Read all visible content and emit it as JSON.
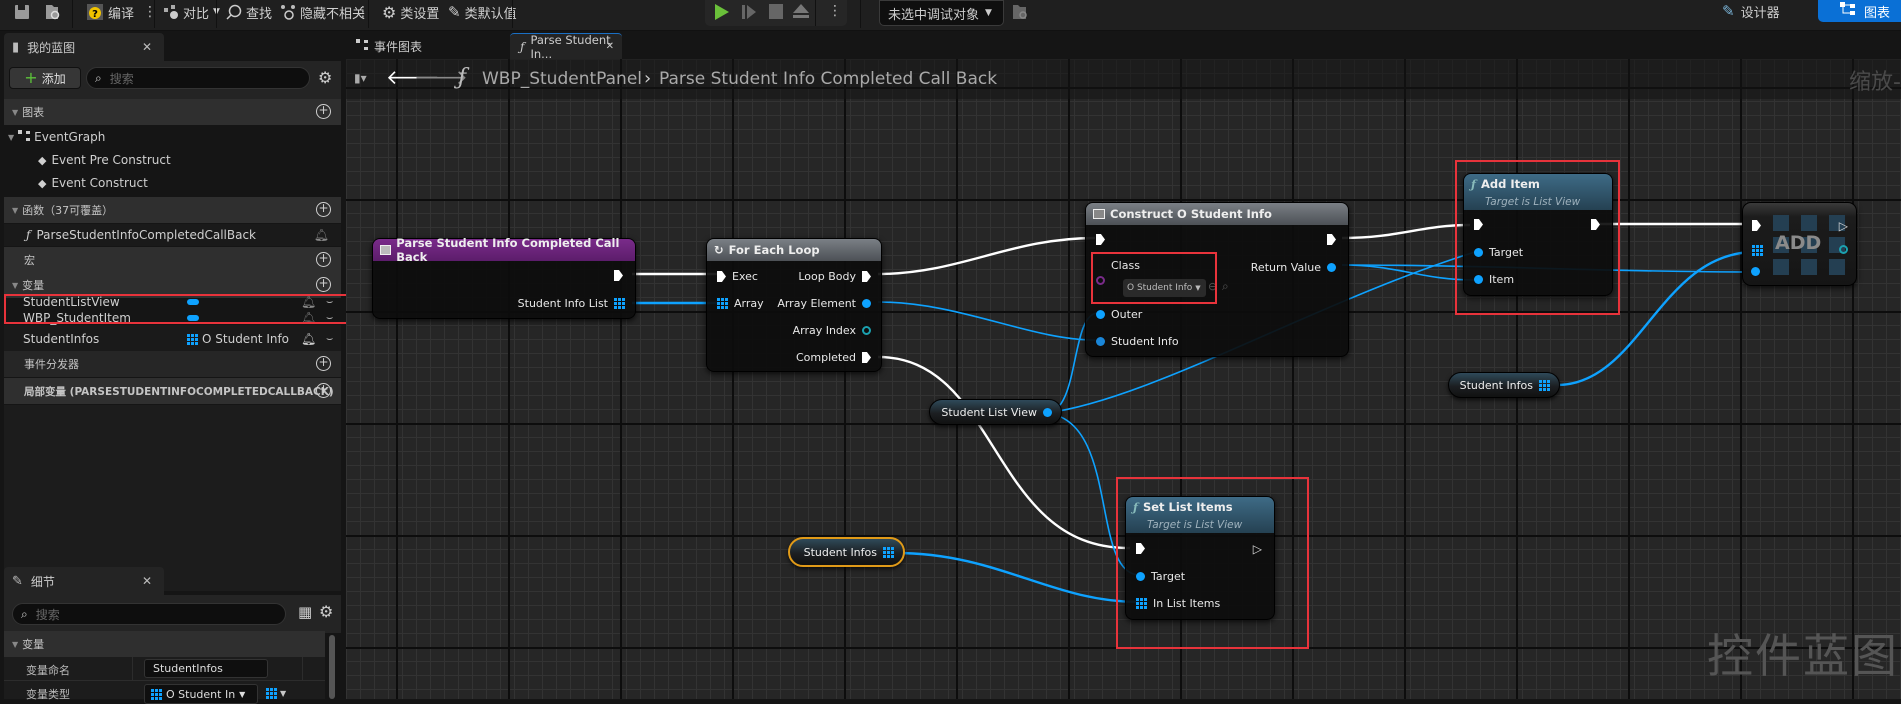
{
  "toolbar": {
    "compile_label": "编译",
    "diff_label": "对比",
    "find_label": "查找",
    "hide_unrelated_label": "隐藏不相关",
    "class_settings_label": "类设置",
    "class_defaults_label": "类默认值",
    "debug_object_label": "未选中调试对象",
    "designer_label": "设计器",
    "graph_label": "图表"
  },
  "my_blueprint": {
    "tab_label": "我的蓝图",
    "add_label": "添加",
    "search_placeholder": "搜索",
    "graphs_section": "图表",
    "event_graph": "EventGraph",
    "events": [
      "Event Pre Construct",
      "Event Construct"
    ],
    "functions_section": "函数（37可覆盖）",
    "function_item": "ParseStudentInfoCompletedCallBack",
    "macros_section": "宏",
    "variables_section": "变量",
    "variables": [
      {
        "name": "StudentListView",
        "type": ""
      },
      {
        "name": "WBP_StudentItem",
        "type": ""
      },
      {
        "name": "StudentInfos",
        "type": "O Student Info"
      }
    ],
    "dispatchers_section": "事件分发器",
    "local_vars_section": "局部变量 (PARSESTUDENTINFOCOMPLETEDCALLBACK)"
  },
  "details": {
    "tab_label": "细节",
    "search_placeholder": "搜索",
    "section": "变量",
    "var_name_label": "变量命名",
    "var_name_value": "StudentInfos",
    "var_type_label": "变量类型",
    "var_type_value": "O Student In"
  },
  "graph_tabs": {
    "event_graph": "事件图表",
    "function_tab": "Parse Student In..."
  },
  "breadcrumb": {
    "blueprint": "WBP_StudentPanel",
    "function": "Parse Student Info Completed Call Back"
  },
  "watermark": {
    "zoom": "缩放-",
    "mode": "控件蓝图"
  },
  "nodes": {
    "entry": {
      "title": "Parse Student Info Completed Call Back",
      "out_pin": "Student Info List"
    },
    "foreach": {
      "title": "For Each Loop",
      "exec": "Exec",
      "array": "Array",
      "loop_body": "Loop Body",
      "array_element": "Array Element",
      "array_index": "Array Index",
      "completed": "Completed"
    },
    "construct": {
      "title": "Construct O Student Info",
      "class": "Class",
      "class_value": "O Student Info",
      "return_value": "Return Value",
      "outer": "Outer",
      "student_info": "Student Info"
    },
    "add_item": {
      "title": "Add Item",
      "subtitle": "Target is List View",
      "target": "Target",
      "item": "Item"
    },
    "add_array": {
      "title": "ADD"
    },
    "set_list_items": {
      "title": "Set List Items",
      "subtitle": "Target is List View",
      "target": "Target",
      "in_list_items": "In List Items"
    },
    "var_student_list_view": "Student List View",
    "var_student_infos_1": "Student Infos",
    "var_student_infos_2": "Student Infos"
  }
}
